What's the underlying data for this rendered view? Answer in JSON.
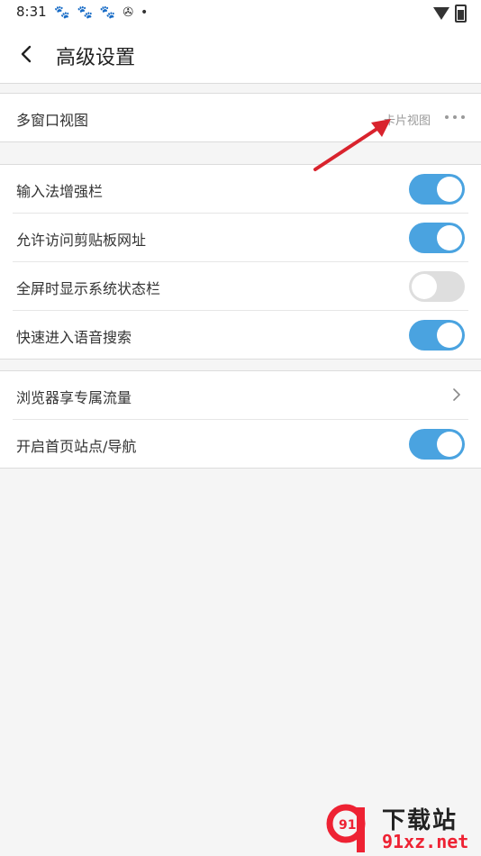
{
  "status": {
    "time": "8:31",
    "icons": [
      "paw-icon",
      "paw-icon",
      "paw-icon",
      "aperture-icon",
      "dot-icon"
    ]
  },
  "header": {
    "title": "高级设置"
  },
  "multiwindow": {
    "label": "多窗口视图",
    "value": "卡片视图"
  },
  "settings_group1": [
    {
      "label": "输入法增强栏",
      "toggle": true
    },
    {
      "label": "允许访问剪贴板网址",
      "toggle": true
    },
    {
      "label": "全屏时显示系统状态栏",
      "toggle": false
    },
    {
      "label": "快速进入语音搜索",
      "toggle": true
    }
  ],
  "settings_group2": [
    {
      "label": "浏览器享专属流量",
      "type": "link"
    },
    {
      "label": "开启首页站点/导航",
      "toggle": true
    }
  ],
  "watermark": {
    "title": "下载站",
    "url": "91xz.net",
    "logo": "91"
  },
  "colors": {
    "accent": "#4aa3e0",
    "arrow": "#d9232d"
  }
}
